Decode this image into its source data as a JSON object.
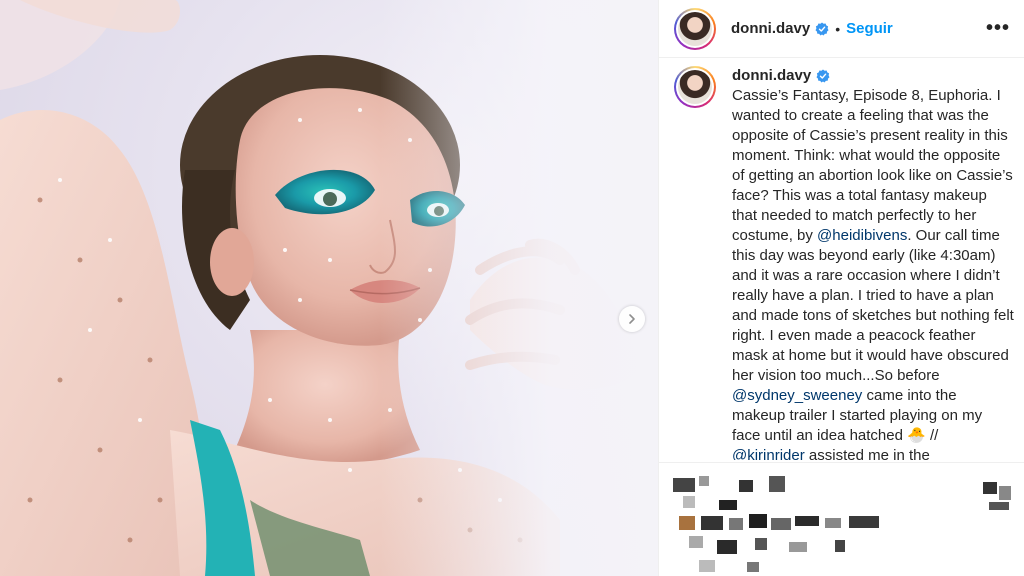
{
  "photo": {
    "alt_icon": "chevron-right-icon"
  },
  "header": {
    "username": "donni.davy",
    "dot": "•",
    "follow_label": "Seguir",
    "more_icon": "more-options-icon",
    "more_label": "•••"
  },
  "caption": {
    "username": "donni.davy",
    "segments": {
      "s1": "Cassie’s Fantasy, Episode 8, Euphoria. I wanted to create a feeling that was the opposite of Cassie’s present reality in this moment. Think: what would the opposite of getting an abortion look like on Cassie’s face? This was a total fantasy makeup that needed to match perfectly to her costume, by ",
      "m1": "@heidibivens",
      "s2": ". Our call time this day was beyond early (like 4:30am) and it was a rare occasion where I didn’t really have a plan. I tried to have a plan and made tons of sketches but nothing felt right. I even made a peacock feather mask at home but it would have obscured her vision too much...So before ",
      "m2": "@sydney_sweeney",
      "s3": " came into the makeup trailer I started playing on my face until an idea hatched ",
      "emoji": "🐣",
      "s4": " // ",
      "m3": "@kirinrider",
      "s5": " assisted me in the painstakingly long precision-"
    }
  },
  "colors": {
    "link": "#0095f6",
    "mention": "#00376b",
    "verified": "#3897f0",
    "teal_makeup": "#1aa7a8"
  }
}
